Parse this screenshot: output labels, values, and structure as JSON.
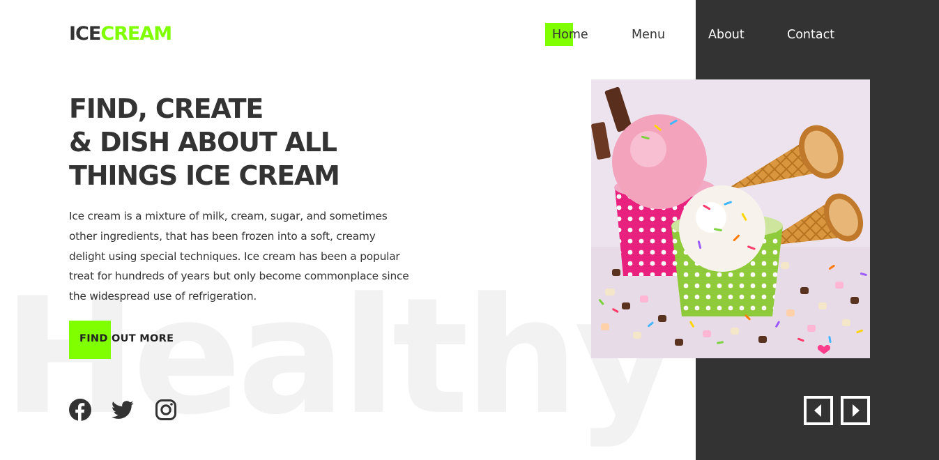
{
  "header": {
    "logo_part1": "ICE",
    "logo_part2": "CREAM",
    "nav": {
      "home": "Home",
      "menu": "Menu",
      "about": "About",
      "contact": "Contact"
    }
  },
  "hero": {
    "headline_line1": "FIND, CREATE",
    "headline_line2": "& DISH ABOUT ALL",
    "headline_line3": "THINGS ICE CREAM",
    "description": "Ice cream is a mixture of milk, cream, sugar, and sometimes other ingredients, that has been frozen into a soft, creamy delight using special techniques. Ice cream has been a popular treat for hundreds of years but only become commonplace since the widespread use of refrigeration.",
    "cta_label": "FIND OUT MORE",
    "background_word": "Healthy"
  },
  "social": {
    "icons": [
      "facebook-icon",
      "twitter-icon",
      "instagram-icon"
    ]
  },
  "carousel": {
    "icons": [
      "arrow-left-icon",
      "arrow-right-icon"
    ]
  },
  "colors": {
    "accent": "#7fff00",
    "dark": "#333333",
    "text": "#333333",
    "watermark": "#f2f2f2",
    "background": "#ffffff"
  }
}
